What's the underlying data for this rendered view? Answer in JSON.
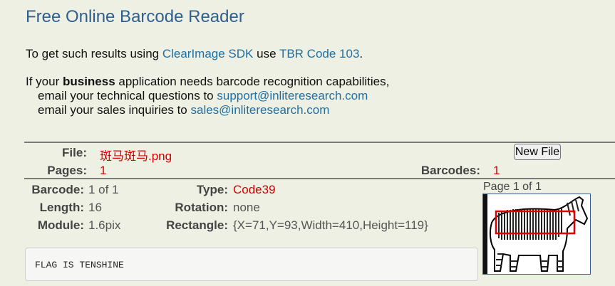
{
  "header": {
    "title": "Free Online Barcode Reader"
  },
  "intro": {
    "prefix": "To get such results using ",
    "sdk_link": "ClearImage SDK",
    "middle": " use ",
    "code_link": "TBR Code 103",
    "suffix": "."
  },
  "business": {
    "line1_prefix": "If your ",
    "line1_bold": "business",
    "line1_suffix": " application needs barcode recognition capabilities,",
    "tech_prefix": "email your technical questions to ",
    "tech_email": "support@inliteresearch.com",
    "sales_prefix": "email your sales inquiries to ",
    "sales_email": "sales@inliteresearch.com"
  },
  "file_info": {
    "file_label": "File:",
    "file_value": "斑马斑马.png",
    "pages_label": "Pages:",
    "pages_value": "1",
    "barcodes_label": "Barcodes:",
    "barcodes_value": "1",
    "new_file_button": "New File"
  },
  "barcode": {
    "barcode_label": "Barcode:",
    "barcode_value": "1 of 1",
    "length_label": "Length:",
    "length_value": "16",
    "module_label": "Module:",
    "module_value": "1.6pix",
    "type_label": "Type:",
    "type_value": "Code39",
    "rotation_label": "Rotation:",
    "rotation_value": "none",
    "rectangle_label": "Rectangle:",
    "rectangle_value": "{X=71,Y=93,Width=410,Height=119}"
  },
  "preview": {
    "page_caption": "Page 1 of 1",
    "image_icon": "zebra-barcode-thumbnail",
    "highlight_color": "#e00000"
  },
  "result": {
    "text": "FLAG IS TENSHINE"
  }
}
